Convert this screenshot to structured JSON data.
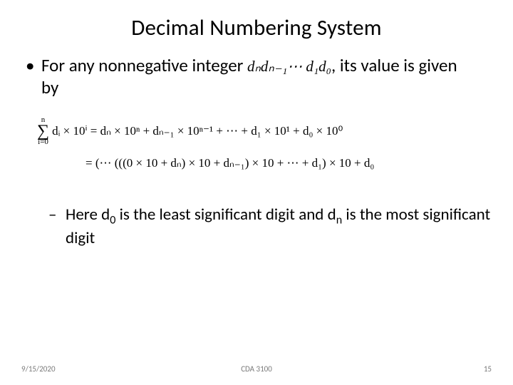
{
  "title": "Decimal Numbering System",
  "bullet1_pre": "For any nonnegative integer ",
  "bullet1_math": "dₙdₙ₋₁⋯ d₁d₀",
  "bullet1_post": ", its value is given by",
  "formula": {
    "sigma_top": "n",
    "sigma_bottom": "i=0",
    "body1": "dᵢ × 10ⁱ = dₙ × 10ⁿ + dₙ₋₁ × 10ⁿ⁻¹ + ⋯ + d₁ × 10¹ + d₀ × 10⁰",
    "body2": "= (⋯ (((0 × 10 + dₙ) × 10 + dₙ₋₁) × 10 + ⋯ + d₁) × 10 + d₀"
  },
  "bullet2_a": "Here d",
  "bullet2_b": " is the least significant digit and d",
  "bullet2_c": " is the most significant digit",
  "sub0": "0",
  "subn": "n",
  "footer": {
    "date": "9/15/2020",
    "course": "CDA 3100",
    "page": "15"
  }
}
